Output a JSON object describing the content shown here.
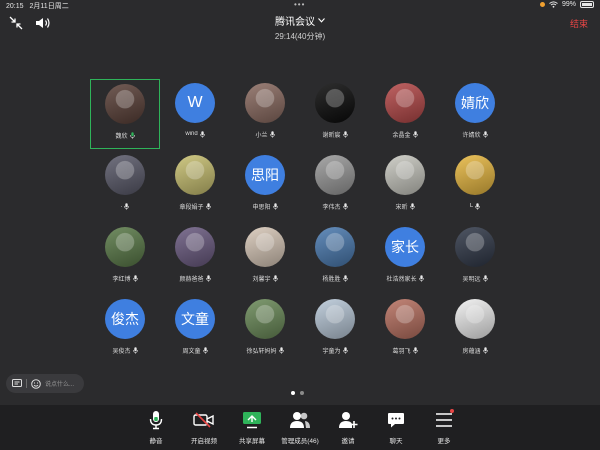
{
  "status_bar": {
    "time": "20:15",
    "date": "2月11日周二",
    "battery": "99%"
  },
  "header": {
    "title": "腾讯会议",
    "duration": "29:14(40分钟)",
    "end_label": "结束"
  },
  "participants": [
    {
      "name": "魏欣",
      "avatar_text": "",
      "avatar_color": "#5a4038",
      "active": true
    },
    {
      "name": "wind",
      "avatar_text": "W",
      "avatar_color": "#3f7fe0",
      "active": false
    },
    {
      "name": "小兰",
      "avatar_text": "",
      "avatar_color": "#8a6a60",
      "active": false
    },
    {
      "name": "谢昕宸",
      "avatar_text": "",
      "avatar_color": "#0a0a0a",
      "active": false
    },
    {
      "name": "余晶金",
      "avatar_text": "",
      "avatar_color": "#b54848",
      "active": false
    },
    {
      "name": "许婧欣",
      "avatar_text": "婧欣",
      "avatar_color": "#3f7fe0",
      "active": false
    },
    {
      "name": ".",
      "avatar_text": "",
      "avatar_color": "#5a5a6a",
      "active": false
    },
    {
      "name": "章段娟子",
      "avatar_text": "",
      "avatar_color": "#c8c070",
      "active": false
    },
    {
      "name": "申思阳",
      "avatar_text": "思阳",
      "avatar_color": "#3f7fe0",
      "active": false
    },
    {
      "name": "李伟杰",
      "avatar_text": "",
      "avatar_color": "#9a9a9a",
      "active": false
    },
    {
      "name": "宋昕",
      "avatar_text": "",
      "avatar_color": "#c8c8c0",
      "active": false
    },
    {
      "name": "L",
      "avatar_text": "",
      "avatar_color": "#e8b840",
      "active": false
    },
    {
      "name": "李红博",
      "avatar_text": "",
      "avatar_color": "#5a7a48",
      "active": false
    },
    {
      "name": "颜赫爸爸",
      "avatar_text": "",
      "avatar_color": "#6a5a80",
      "active": false
    },
    {
      "name": "刘馨宇",
      "avatar_text": "",
      "avatar_color": "#d8c8b8",
      "active": false
    },
    {
      "name": "杨胜胜",
      "avatar_text": "",
      "avatar_color": "#4a7ab0",
      "active": false
    },
    {
      "name": "杜浩然家长",
      "avatar_text": "家长",
      "avatar_color": "#3f7fe0",
      "active": false
    },
    {
      "name": "吴明远",
      "avatar_text": "",
      "avatar_color": "#303848",
      "active": false
    },
    {
      "name": "吴俊杰",
      "avatar_text": "俊杰",
      "avatar_color": "#3f7fe0",
      "active": false
    },
    {
      "name": "周文童",
      "avatar_text": "文童",
      "avatar_color": "#3f7fe0",
      "active": false
    },
    {
      "name": "徐弘轩妈妈",
      "avatar_text": "",
      "avatar_color": "#6a8a58",
      "active": false
    },
    {
      "name": "宇童为",
      "avatar_text": "",
      "avatar_color": "#b8c8d8",
      "active": false
    },
    {
      "name": "葛羽飞",
      "avatar_text": "",
      "avatar_color": "#b87060",
      "active": false
    },
    {
      "name": "房蕴涵",
      "avatar_text": "",
      "avatar_color": "#f0f0f0",
      "active": false
    }
  ],
  "chat": {
    "placeholder": "说点什么..."
  },
  "toolbar": [
    {
      "label": "静音",
      "icon": "microphone-icon"
    },
    {
      "label": "开启视频",
      "icon": "video-off-icon"
    },
    {
      "label": "共享屏幕",
      "icon": "share-screen-icon"
    },
    {
      "label": "管理成员(46)",
      "icon": "members-icon"
    },
    {
      "label": "邀请",
      "icon": "invite-icon"
    },
    {
      "label": "聊天",
      "icon": "chat-icon"
    },
    {
      "label": "更多",
      "icon": "more-icon"
    }
  ],
  "colors": {
    "accent_green": "#2fb35a",
    "end_red": "#e84545",
    "avatar_blue": "#3f7fe0"
  }
}
